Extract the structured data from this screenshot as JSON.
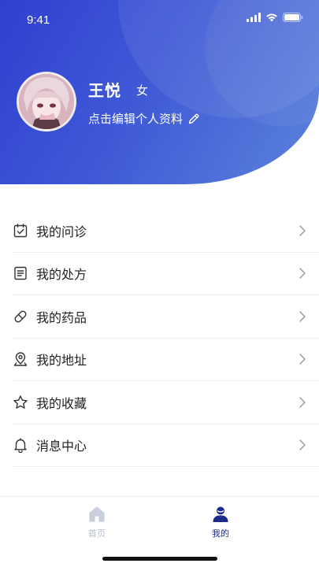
{
  "status_bar": {
    "time": "9:41"
  },
  "profile": {
    "name": "王悦",
    "gender": "女",
    "edit_text": "点击编辑个人资料"
  },
  "menu": {
    "items": [
      {
        "label": "我的问诊",
        "icon": "calendar-check-icon"
      },
      {
        "label": "我的处方",
        "icon": "document-list-icon"
      },
      {
        "label": "我的药品",
        "icon": "pill-icon"
      },
      {
        "label": "我的地址",
        "icon": "location-pin-icon"
      },
      {
        "label": "我的收藏",
        "icon": "star-icon"
      },
      {
        "label": "消息中心",
        "icon": "bell-icon"
      }
    ]
  },
  "tabbar": {
    "home_label": "首页",
    "mine_label": "我的"
  },
  "colors": {
    "header_start": "#2f3fcf",
    "header_end": "#5b83db",
    "tab_active": "#1c2a8a",
    "tab_inactive": "#b8bdca"
  }
}
